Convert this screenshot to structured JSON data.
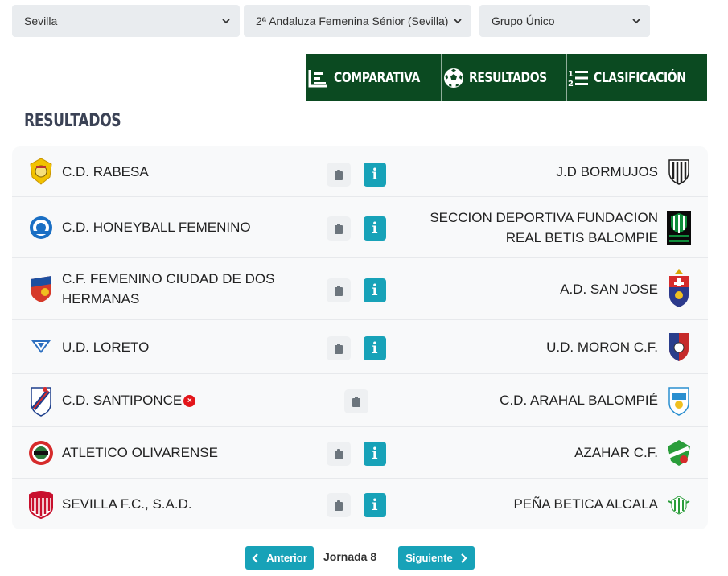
{
  "filters": {
    "province": "Sevilla",
    "competition": "2ª Andaluza Femenina Sénior (Sevilla)",
    "group": "Grupo Único"
  },
  "tabs": [
    {
      "label": "COMPARATIVA",
      "icon": "bar-chart-icon"
    },
    {
      "label": "RESULTADOS",
      "icon": "soccer-ball-icon"
    },
    {
      "label": "CLASIFICACIÓN",
      "icon": "ranking-list-icon"
    }
  ],
  "section_title": "RESULTADOS",
  "matches": [
    {
      "home": "C.D. RABESA",
      "away": "J.D BORMUJOS",
      "info": "i"
    },
    {
      "home": "C.D. HONEYBALL FEMENINO",
      "away": "SECCION DEPORTIVA FUNDACION REAL BETIS BALOMPIE",
      "info": "i"
    },
    {
      "home": "C.F. FEMENINO CIUDAD DE DOS HERMANAS",
      "away": "A.D. SAN JOSE",
      "info": "i"
    },
    {
      "home": "U.D. LORETO",
      "away": "U.D. MORON C.F.",
      "info": "i"
    },
    {
      "home": "C.D. SANTIPONCE",
      "away": "C.D. ARAHAL BALOMPIÉ",
      "home_badge": "×"
    },
    {
      "home": "ATLETICO OLIVARENSE",
      "away": "AZAHAR C.F.",
      "info": "i"
    },
    {
      "home": "SEVILLA F.C., S.A.D.",
      "away": "PEÑA BETICA ALCALA",
      "info": "i"
    }
  ],
  "pagination": {
    "prev": "Anterior",
    "current": "Jornada 8",
    "next": "Siguiente"
  },
  "colors": {
    "tab_bar": "#0b4a21",
    "accent": "#17a2b8",
    "cancelled": "#e3151a"
  }
}
